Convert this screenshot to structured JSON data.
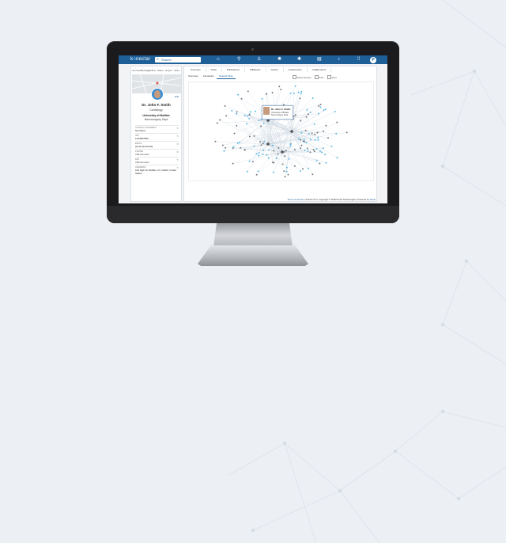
{
  "header": {
    "logo_prefix": "k",
    "logo_accent": "o",
    "logo_suffix": "nectar",
    "search_placeholder": "Search",
    "nav_icons": [
      "home-icon",
      "search-icon",
      "profile-icon",
      "network-icon",
      "hub-icon",
      "analytics-icon",
      "bell-icon",
      "apps-icon"
    ],
    "avatar_initial": "P"
  },
  "profile": {
    "tools": [
      "Connect",
      "Message",
      "Follow",
      "Share",
      "Export",
      "More"
    ],
    "edit_label": "Edit",
    "name": "Dr. John F. Smith",
    "specialty": "Cardiology",
    "university": "University of Buffalo",
    "department": "Neurosurgery Dept",
    "sections": [
      {
        "label": "CLINICAL INTEREST",
        "value": "Not Filled"
      },
      {
        "label": "NPI",
        "value": "1234567890"
      },
      {
        "label": "EMAIL",
        "value": "[email protected]"
      },
      {
        "label": "PHONE",
        "value": "716-xxx-xxxx"
      },
      {
        "label": "FAX",
        "value": "716-xxx-xxxx"
      },
      {
        "label": "ADDRESS",
        "value": "100 High St, Buffalo, NY 14203, United States"
      }
    ]
  },
  "main": {
    "tabs": [
      "Overview",
      "Trials",
      "Publications",
      "Affiliations",
      "Grants",
      "Conferences",
      "Collaborators"
    ],
    "subtabs": [
      "Summary",
      "Interaction",
      "Network Map"
    ],
    "active_subtab": 2,
    "legend": [
      "Show Names",
      "KOL",
      "Peer"
    ],
    "tooltip": {
      "name": "Dr. John F. Smith",
      "line1": "University of Buffalo",
      "line2": "Neurosurgery Dept"
    }
  },
  "footer": {
    "terms": "Terms of Service",
    "text": " | KOLM v3.4 | Copyright © 2018 Kanat Technologies | Powered by ",
    "brand": "Kanat"
  },
  "colors": {
    "brand": "#1f5f98",
    "accent": "#6ec1ff",
    "node_blue": "#5bb8e6",
    "node_gray": "#777a80"
  }
}
